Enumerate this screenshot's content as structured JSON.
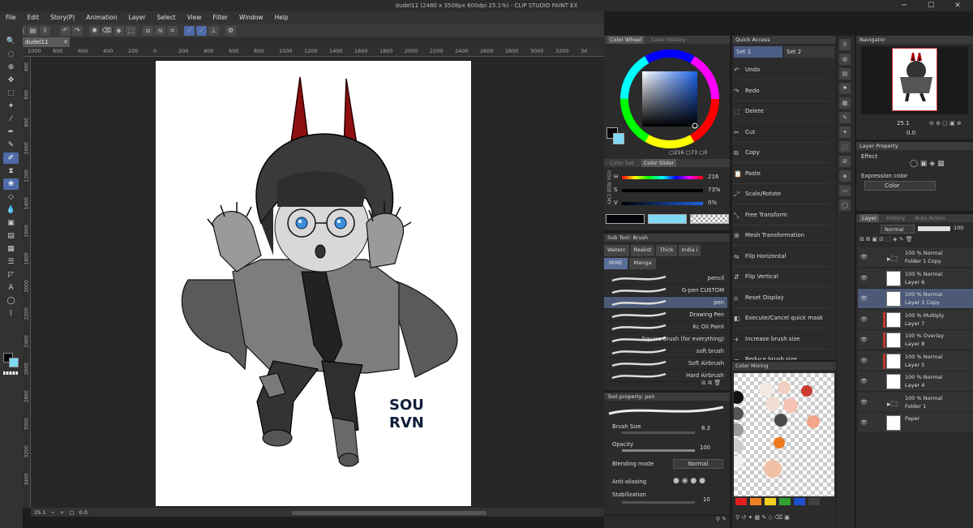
{
  "window": {
    "title": "dudel11 (2480 x 3508px 600dpi 25.1%) - CLIP STUDIO PAINT EX",
    "min": "─",
    "max": "☐",
    "close": "✕"
  },
  "menu": [
    "File",
    "Edit",
    "Story(P)",
    "Animation",
    "Layer",
    "Select",
    "View",
    "Filter",
    "Window",
    "Help"
  ],
  "document": {
    "tab": "dudel11",
    "close": "✕"
  },
  "ruler": {
    "h": [
      "1000",
      "800",
      "600",
      "400",
      "200",
      "0",
      "200",
      "400",
      "600",
      "800",
      "1000",
      "1200",
      "1400",
      "1600",
      "1800",
      "2000",
      "2200",
      "2400",
      "2600",
      "2800",
      "3000",
      "3200",
      "34"
    ],
    "v": [
      "400",
      "600",
      "800",
      "1000",
      "1200",
      "1400",
      "1600",
      "1800",
      "2000",
      "2200",
      "2400",
      "2600",
      "2800",
      "3000",
      "3200",
      "3400"
    ]
  },
  "status": {
    "zoom": "25.1",
    "angle": "0.0"
  },
  "signature": {
    "line1": "SOU",
    "line2": "RVN"
  },
  "color_wheel": {
    "tab_active": "Color Wheel",
    "tab_other": "Color History",
    "h": "216",
    "s": "73",
    "v": "0",
    "main_color": "#050509",
    "sub_color": "#7fd8f5"
  },
  "color_slider": {
    "tab_other": "Color Set",
    "tab_active": "Color Slider",
    "mode_labels": "HSV RGB CMY",
    "h_label": "H",
    "s_label": "S",
    "v_label": "V",
    "h_value": "216",
    "s_value": "73%",
    "v_value": "0%"
  },
  "sub_tool": {
    "title": "Sub Tool: Brush",
    "tabs": [
      "Waterc",
      "Realist",
      "Thick",
      "India i"
    ],
    "tab_row2": [
      "MINE",
      "Manga"
    ],
    "brushes": [
      "pencil",
      "G-pen CUSTOM",
      "pen",
      "Drawing Pen",
      "Kc Oil Paint",
      "Square Brush (for everything)",
      "soft brush",
      "Soft Airbrush",
      "Hard Airbrush"
    ],
    "selected_brush": "pen"
  },
  "tool_property": {
    "title": "Tool property: pen",
    "brush_size_label": "Brush Size",
    "brush_size": "8.3",
    "opacity_label": "Opacity",
    "opacity": "100",
    "blending_label": "Blending mode",
    "blending": "Normal",
    "antialias_label": "Anti-aliasing",
    "stabilization_label": "Stabilization",
    "stabilization": "10"
  },
  "quick_access": {
    "title": "Quick Access",
    "set1": "Set 1",
    "set2": "Set 2",
    "items": [
      "Undo",
      "Redo",
      "Delete",
      "Cut",
      "Copy",
      "Paste",
      "Scale/Rotate",
      "Free Transform",
      "Mesh Transformation",
      "Flip Horizontal",
      "Flip Vertical",
      "Reset Display",
      "Execute/Cancel quick mask",
      "Increase brush size",
      "Reduce brush size"
    ],
    "icons": [
      "↶",
      "↷",
      "⬚",
      "✂",
      "⧉",
      "📋",
      "⤢",
      "⤡",
      "⊞",
      "⇋",
      "⇵",
      "⌂",
      "◧",
      "+",
      "−"
    ]
  },
  "color_mixing": {
    "title": "Color Mixing",
    "dots": [
      "#f4e8e2",
      "#f0cfc2",
      "#cc3b30",
      "#f2ddd4",
      "#f6c2b2",
      "#4a4a4a",
      "#f2a58a",
      "#ee7a20",
      "#f0c0a4"
    ],
    "palette": [
      "#e02020",
      "#f08020",
      "#f0d020",
      "#30a030",
      "#2050d0",
      "#404040"
    ]
  },
  "navigator": {
    "title": "Navigator",
    "zoom": "25.1",
    "angle": "0.0"
  },
  "layer_property": {
    "title": "Layer Property",
    "effect": "Effect",
    "expression_label": "Expression color",
    "expression_value": "Color"
  },
  "layer_panel": {
    "tab_active": "Layer",
    "tab_other1": "History",
    "tab_other2": "Auto Action",
    "blend": "Normal",
    "opacity": "100",
    "layers": [
      {
        "l1": "100 % Normal",
        "l2": "Folder 1 Copy",
        "folder": true,
        "color": ""
      },
      {
        "l1": "100 % Normal",
        "l2": "Layer 6",
        "folder": false,
        "color": ""
      },
      {
        "l1": "100 % Normal",
        "l2": "Layer 1 Copy",
        "folder": false,
        "color": "",
        "selected": true
      },
      {
        "l1": "100 % Multiply",
        "l2": "Layer 7",
        "folder": false,
        "color": "#c0392b"
      },
      {
        "l1": "100 % Overlay",
        "l2": "Layer 8",
        "folder": false,
        "color": "#c0392b"
      },
      {
        "l1": "100 % Normal",
        "l2": "Layer 5",
        "folder": false,
        "color": "#c0392b"
      },
      {
        "l1": "100 % Normal",
        "l2": "Layer 4",
        "folder": false,
        "color": ""
      },
      {
        "l1": "100 % Normal",
        "l2": "Folder 1",
        "folder": true,
        "color": ""
      },
      {
        "l1": "Paper",
        "l2": "",
        "folder": false,
        "color": ""
      }
    ]
  }
}
